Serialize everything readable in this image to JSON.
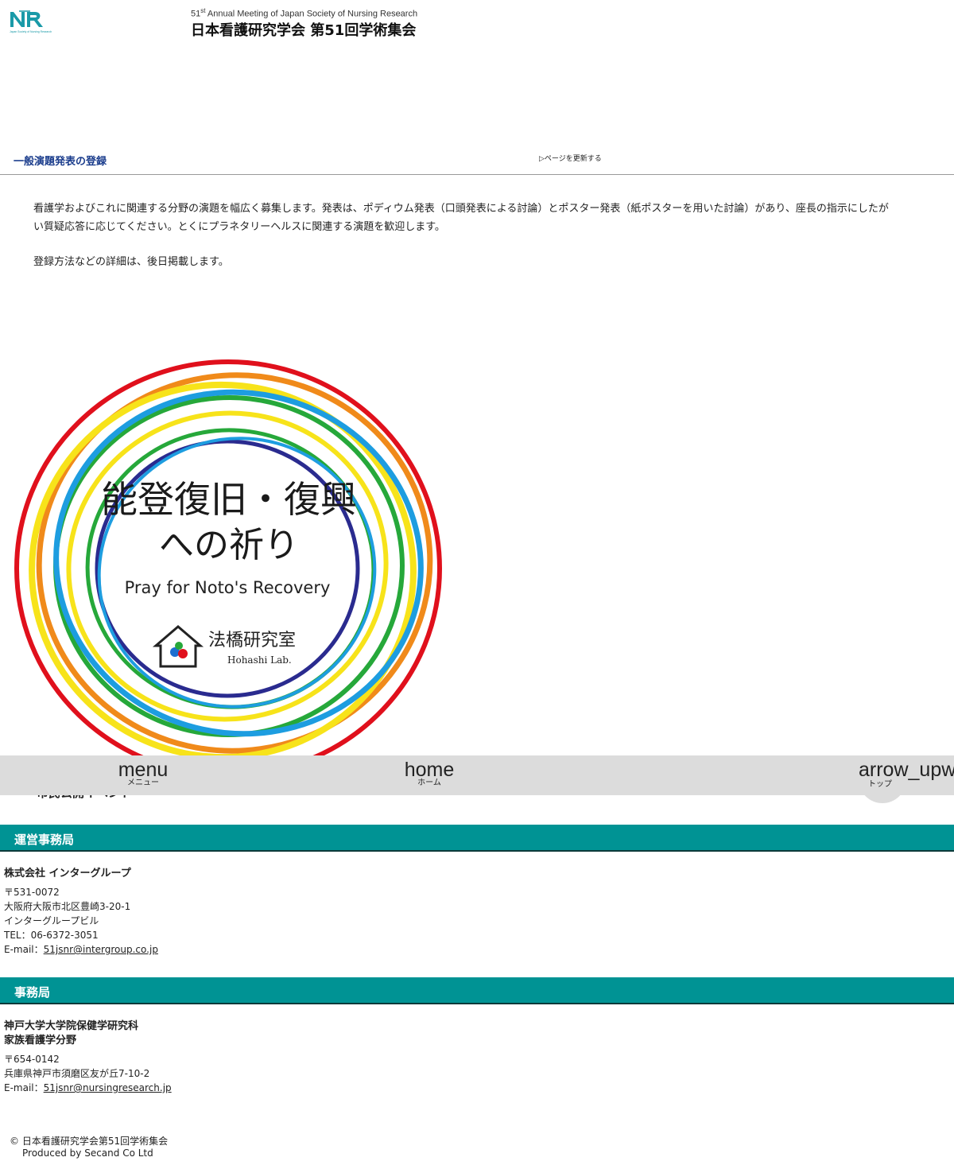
{
  "header": {
    "logo_text": "NR",
    "logo_caption": "Japan Society of Nursing Research",
    "subtitle_ordinal": "51",
    "subtitle_sup": "st",
    "subtitle_rest": " Annual Meeting of Japan Society of Nursing Research",
    "title": "日本看護研究学会 第51回学術集会"
  },
  "section": {
    "heading": "一般演題発表の登録",
    "refresh_link": "▷ページを更新する"
  },
  "intro": {
    "paragraph1": "看護学およびこれに関連する分野の演題を幅広く募集します。発表は、ポディウム発表（口頭発表による討論）とポスター発表（紙ポスターを用いた討論）があり、座長の指示にしたがい質疑応答に応じてください。とくにプラネタリーヘルスに関連する演題を歓迎します。",
    "paragraph2": "登録方法などの詳細は、後日掲載します。"
  },
  "banner": {
    "line1": "能登復旧・復興",
    "line2": "への祈り",
    "english": "Pray for Noto's Recovery",
    "lab_jp": "法橋研究室",
    "lab_en": "Hohashi Lab."
  },
  "hidden_caption": "市民公開イベント",
  "bottom_nav": {
    "menu_label": "menu",
    "menu_sub": "メニュー",
    "home_label": "home",
    "home_sub": "ホーム",
    "top_label": "arrow_upward",
    "top_sub": "トップ"
  },
  "office": {
    "heading": "運営事務局",
    "org": "株式会社 インターグループ",
    "postal": "〒531-0072",
    "address": "大阪府大阪市北区豊崎3-20-1",
    "building": "インターグループビル",
    "tel": "TEL：06-6372-3051",
    "email_prefix": "E-mail：",
    "email": "51jsnr@intergroup.co.jp"
  },
  "secretariat": {
    "heading": "事務局",
    "org_line1": "神戸大学大学院保健学研究科",
    "org_line2": "家族看護学分野",
    "postal": "〒654-0142",
    "address": "兵庫県神戸市須磨区友が丘7-10-2",
    "email_prefix": "E-mail：",
    "email": "51jsnr@nursingresearch.jp"
  },
  "footer": {
    "copyright": "© 日本看護研究学会第51回学術集会",
    "produced_by": "Produced by Secand Co Ltd"
  },
  "colors": {
    "band": "#009394",
    "heading_blue": "#1a3c8c",
    "logo_teal": "#1a9aa8",
    "nav_bg": "#dcdcdc"
  }
}
